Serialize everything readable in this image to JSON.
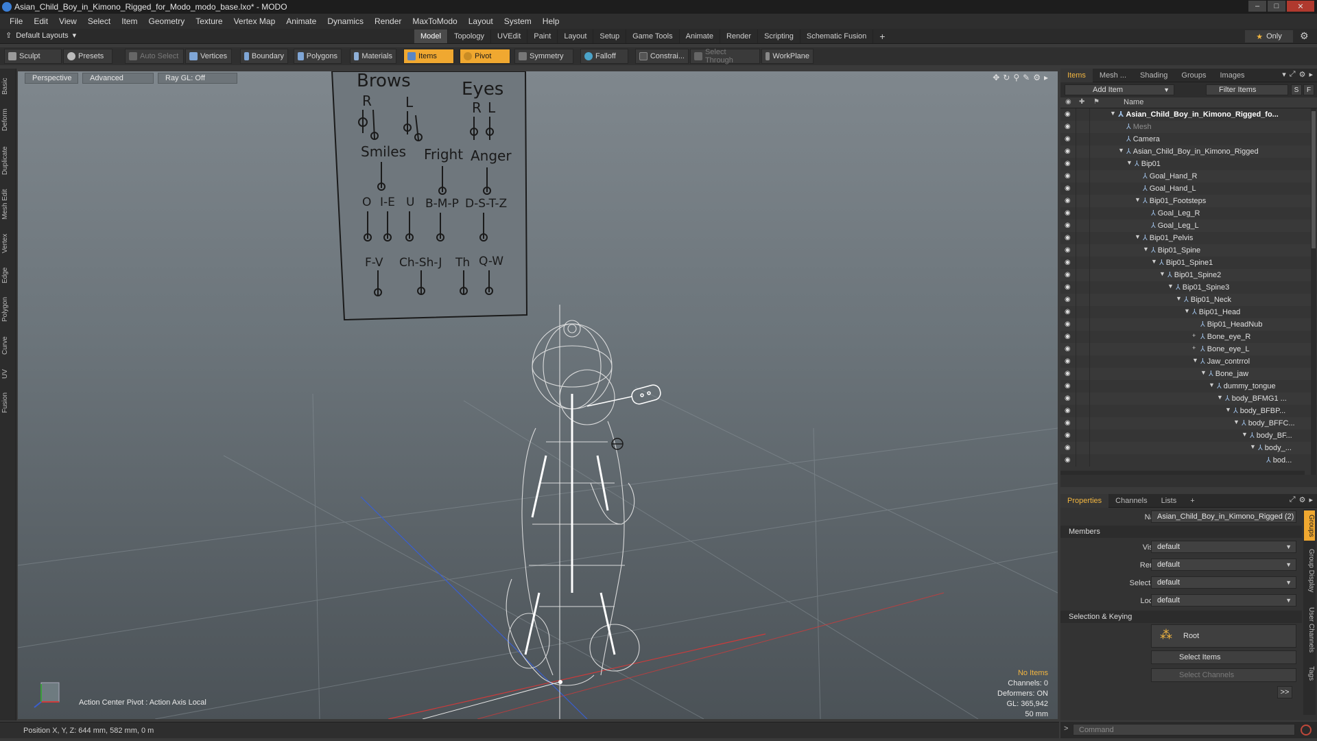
{
  "window": {
    "title": "Asian_Child_Boy_in_Kimono_Rigged_for_Modo_modo_base.lxo* - MODO",
    "controls": [
      "–",
      "□",
      "✕"
    ]
  },
  "menu": [
    "File",
    "Edit",
    "View",
    "Select",
    "Item",
    "Geometry",
    "Texture",
    "Vertex Map",
    "Animate",
    "Dynamics",
    "Render",
    "MaxToModo",
    "Layout",
    "System",
    "Help"
  ],
  "layout_bar": {
    "layouts_label": "Default Layouts",
    "tabs": [
      {
        "label": "Model",
        "active": true
      },
      {
        "label": "Topology",
        "active": false
      },
      {
        "label": "UVEdit",
        "active": false
      },
      {
        "label": "Paint",
        "active": false
      },
      {
        "label": "Layout",
        "active": false
      },
      {
        "label": "Setup",
        "active": false
      },
      {
        "label": "Game Tools",
        "active": false
      },
      {
        "label": "Animate",
        "active": false
      },
      {
        "label": "Render",
        "active": false
      },
      {
        "label": "Scripting",
        "active": false
      },
      {
        "label": "Schematic Fusion",
        "active": false
      }
    ],
    "add_tab": "+",
    "only_label": "Only"
  },
  "toolbar": {
    "sculpt": "Sculpt",
    "presets": "Presets",
    "auto_select": "Auto Select",
    "vertices": "Vertices",
    "boundary": "Boundary",
    "polygons": "Polygons",
    "materials": "Materials",
    "items": "Items",
    "pivot": "Pivot",
    "symmetry": "Symmetry",
    "falloff": "Falloff",
    "constrain": "Constrai...",
    "select_through": "Select Through",
    "workplane": "WorkPlane"
  },
  "left_tabs": [
    "Basic",
    "Deform",
    "Duplicate",
    "Mesh Edit",
    "Vertex",
    "Edge",
    "Polygon",
    "Curve",
    "UV",
    "Fusion"
  ],
  "viewport": {
    "view_mode": "Perspective",
    "shading": "Advanced",
    "raygl": "Ray GL: Off",
    "action_center": "Action Center Pivot : Action Axis Local",
    "stats": {
      "no_items": "No Items",
      "channels": "Channels: 0",
      "deformers": "Deformers: ON",
      "gl": "GL: 365,942",
      "focal": "50 mm"
    },
    "face_chart": {
      "brows": "Brows",
      "eyes": "Eyes",
      "r": "R",
      "l": "L",
      "smiles": "Smiles",
      "fright": "Fright",
      "anger": "Anger",
      "o": "O",
      "ie": "I-E",
      "u": "U",
      "bmp": "B-M-P",
      "dstz": "D-S-T-Z",
      "fv": "F-V",
      "chshj": "Ch-Sh-J",
      "th": "Th",
      "qw": "Q-W"
    }
  },
  "status_bar": {
    "position": "Position X, Y, Z:   644 mm, 582 mm, 0 m"
  },
  "items_panel": {
    "tabs": [
      {
        "label": "Items",
        "active": true
      },
      {
        "label": "Mesh ...",
        "active": false
      },
      {
        "label": "Shading",
        "active": false
      },
      {
        "label": "Groups",
        "active": false
      },
      {
        "label": "Images",
        "active": false
      }
    ],
    "add_item": "Add Item",
    "filter_items": "Filter Items",
    "s_btn": "S",
    "f_btn": "F",
    "name_col": "Name",
    "tree": [
      {
        "label": "Asian_Child_Boy_in_Kimono_Rigged_fo...",
        "indent": 0,
        "twisty": "▼",
        "style": "bold"
      },
      {
        "label": "Mesh",
        "indent": 1,
        "twisty": "",
        "style": "dim"
      },
      {
        "label": "Camera",
        "indent": 1,
        "twisty": "",
        "style": ""
      },
      {
        "label": "Asian_Child_Boy_in_Kimono_Rigged",
        "indent": 1,
        "twisty": "▼",
        "style": ""
      },
      {
        "label": "Bip01",
        "indent": 2,
        "twisty": "▼",
        "style": ""
      },
      {
        "label": "Goal_Hand_R",
        "indent": 3,
        "twisty": "",
        "style": ""
      },
      {
        "label": "Goal_Hand_L",
        "indent": 3,
        "twisty": "",
        "style": ""
      },
      {
        "label": "Bip01_Footsteps",
        "indent": 3,
        "twisty": "▼",
        "style": ""
      },
      {
        "label": "Goal_Leg_R",
        "indent": 4,
        "twisty": "",
        "style": ""
      },
      {
        "label": "Goal_Leg_L",
        "indent": 4,
        "twisty": "",
        "style": ""
      },
      {
        "label": "Bip01_Pelvis",
        "indent": 3,
        "twisty": "▼",
        "style": ""
      },
      {
        "label": "Bip01_Spine",
        "indent": 4,
        "twisty": "▼",
        "style": ""
      },
      {
        "label": "Bip01_Spine1",
        "indent": 5,
        "twisty": "▼",
        "style": ""
      },
      {
        "label": "Bip01_Spine2",
        "indent": 6,
        "twisty": "▼",
        "style": ""
      },
      {
        "label": "Bip01_Spine3",
        "indent": 7,
        "twisty": "▼",
        "style": ""
      },
      {
        "label": "Bip01_Neck",
        "indent": 8,
        "twisty": "▼",
        "style": ""
      },
      {
        "label": "Bip01_Head",
        "indent": 9,
        "twisty": "▼",
        "style": ""
      },
      {
        "label": "Bip01_HeadNub",
        "indent": 10,
        "twisty": "",
        "style": ""
      },
      {
        "label": "Bone_eye_R",
        "indent": 10,
        "twisty": "+",
        "style": ""
      },
      {
        "label": "Bone_eye_L",
        "indent": 10,
        "twisty": "+",
        "style": ""
      },
      {
        "label": "Jaw_contrrol",
        "indent": 10,
        "twisty": "▼",
        "style": ""
      },
      {
        "label": "Bone_jaw",
        "indent": 11,
        "twisty": "▼",
        "style": ""
      },
      {
        "label": "dummy_tongue",
        "indent": 12,
        "twisty": "▼",
        "style": ""
      },
      {
        "label": "body_BFMG1 ...",
        "indent": 13,
        "twisty": "▼",
        "style": ""
      },
      {
        "label": "body_BFBP...",
        "indent": 14,
        "twisty": "▼",
        "style": ""
      },
      {
        "label": "body_BFFC...",
        "indent": 15,
        "twisty": "▼",
        "style": ""
      },
      {
        "label": "body_BF...",
        "indent": 16,
        "twisty": "▼",
        "style": ""
      },
      {
        "label": "body_...",
        "indent": 17,
        "twisty": "▼",
        "style": ""
      },
      {
        "label": "bod...",
        "indent": 18,
        "twisty": "",
        "style": ""
      }
    ]
  },
  "properties_panel": {
    "tabs": [
      {
        "label": "Properties",
        "active": true
      },
      {
        "label": "Channels",
        "active": false
      },
      {
        "label": "Lists",
        "active": false
      },
      {
        "label": "+",
        "active": false
      }
    ],
    "name_label": "Name",
    "name_value": "Asian_Child_Boy_in_Kimono_Rigged (2)",
    "members_header": "Members",
    "visible_label": "Visible",
    "visible_value": "default",
    "render_label": "Render",
    "render_value": "default",
    "selectable_label": "Selectable",
    "selectable_value": "default",
    "locked_label": "Locked",
    "locked_value": "default",
    "selection_header": "Selection & Keying",
    "root_label": "Root",
    "select_items": "Select Items",
    "select_channels": "Select Channels",
    "more": ">>",
    "side_tabs": [
      "Groups",
      "Group Display",
      "User Channels",
      "Tags"
    ]
  },
  "command": {
    "prompt": ">",
    "placeholder": "Command"
  },
  "colors": {
    "accent_orange": "#f0a830",
    "x_axis": "#d03a3a",
    "y_axis": "#3a9d3a",
    "z_axis": "#3a5fd0"
  }
}
